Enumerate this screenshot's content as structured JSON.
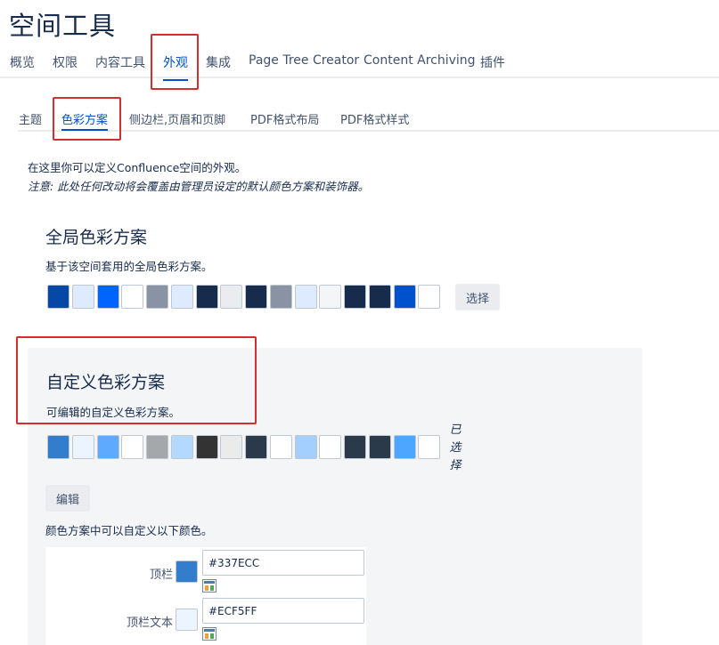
{
  "page": {
    "title": "空间工具"
  },
  "main_tabs": [
    {
      "label": "概览"
    },
    {
      "label": "权限"
    },
    {
      "label": "内容工具"
    },
    {
      "label": "外观"
    },
    {
      "label": "集成"
    },
    {
      "label": "Page Tree Creator"
    },
    {
      "label": "Content Archiving"
    },
    {
      "label": "插件"
    }
  ],
  "sub_tabs": [
    {
      "label": "主题"
    },
    {
      "label": "色彩方案"
    },
    {
      "label": "侧边栏,页眉和页脚"
    },
    {
      "label": "PDF格式布局"
    },
    {
      "label": "PDF格式样式"
    }
  ],
  "intro": {
    "description": "在这里你可以定义Confluence空间的外观。",
    "note": "注意: 此处任何改动将会覆盖由管理员设定的默认颜色方案和装饰器。"
  },
  "global_scheme": {
    "title": "全局色彩方案",
    "subtitle": "基于该空间套用的全局色彩方案。",
    "swatches": [
      "#0747a6",
      "#deebff",
      "#0065ff",
      "#ffffff",
      "#8993a4",
      "#deebff",
      "#172b4d",
      "#ebecf0",
      "#172b4d",
      "#8993a4",
      "#deebff",
      "#f4f5f7",
      "#172b4d",
      "#172b4d",
      "#0052cc",
      "#ffffff"
    ],
    "select_button": "选择"
  },
  "custom_scheme": {
    "title": "自定义色彩方案",
    "subtitle": "可编辑的自定义色彩方案。",
    "swatches": [
      "#337ecc",
      "#ecf5ff",
      "#5eaaff",
      "#ffffff",
      "#a5a7aa",
      "#b3d9ff",
      "#333333",
      "#ebebeb",
      "#2a3a4a",
      "#ffffff",
      "#a3cfff",
      "#ffffff",
      "#2a3a4a",
      "#2a3a4a",
      "#4da6ff",
      "#ffffff"
    ],
    "selected_label": "已选择",
    "edit_button": "编辑",
    "fields_intro": "颜色方案中可以自定义以下颜色。",
    "fields": [
      {
        "label": "顶栏",
        "value": "#337ECC",
        "color": "#337ECC"
      },
      {
        "label": "顶栏文本",
        "value": "#ECF5FF",
        "color": "#ECF5FF"
      }
    ]
  },
  "colors": {
    "accent": "#0052cc",
    "highlight_box": "#d32f2f",
    "text": "#172b4d"
  }
}
